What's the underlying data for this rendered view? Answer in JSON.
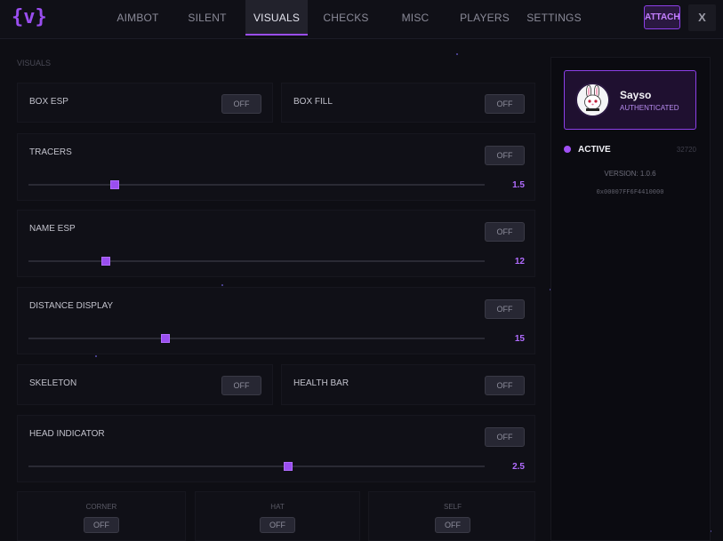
{
  "app": {
    "logo": "{v}"
  },
  "nav": {
    "tabs": [
      {
        "label": "AIMBOT",
        "active": false
      },
      {
        "label": "SILENT",
        "active": false
      },
      {
        "label": "VISUALS",
        "active": true
      },
      {
        "label": "CHECKS",
        "active": false
      },
      {
        "label": "MISC",
        "active": false
      },
      {
        "label": "PLAYERS",
        "active": false
      },
      {
        "label": "SETTINGS",
        "active": false
      }
    ],
    "attach_label": "ATTACH",
    "close_label": "X"
  },
  "visuals": {
    "section_title": "VISUALS",
    "box_esp": {
      "label": "BOX ESP",
      "toggle": "OFF"
    },
    "box_fill": {
      "label": "BOX FILL",
      "toggle": "OFF"
    },
    "tracers": {
      "label": "TRACERS",
      "toggle": "OFF",
      "value": "1.5",
      "level": 0.19
    },
    "name_esp": {
      "label": "NAME ESP",
      "toggle": "OFF",
      "value": "12",
      "level": 0.17
    },
    "distance_display": {
      "label": "DISTANCE DISPLAY",
      "toggle": "OFF",
      "value": "15",
      "level": 0.3
    },
    "skeleton": {
      "label": "SKELETON",
      "toggle": "OFF"
    },
    "health_bar": {
      "label": "HEALTH BAR",
      "toggle": "OFF"
    },
    "head_indicator": {
      "label": "HEAD INDICATOR",
      "toggle": "OFF",
      "value": "2.5",
      "level": 0.57
    },
    "corner": {
      "label": "CORNER",
      "toggle": "OFF"
    },
    "hat": {
      "label": "HAT",
      "toggle": "OFF"
    },
    "self": {
      "label": "SELF",
      "toggle": "OFF"
    }
  },
  "profile": {
    "name": "Sayso",
    "status": "AUTHENTICATED",
    "state": "ACTIVE",
    "id": "32720",
    "version": "VERSION: 1.0.6",
    "address": "0x00007FF6F4410000"
  },
  "colors": {
    "accent": "#9a4ef0",
    "background": "#0e0e14",
    "card": "#101017"
  }
}
